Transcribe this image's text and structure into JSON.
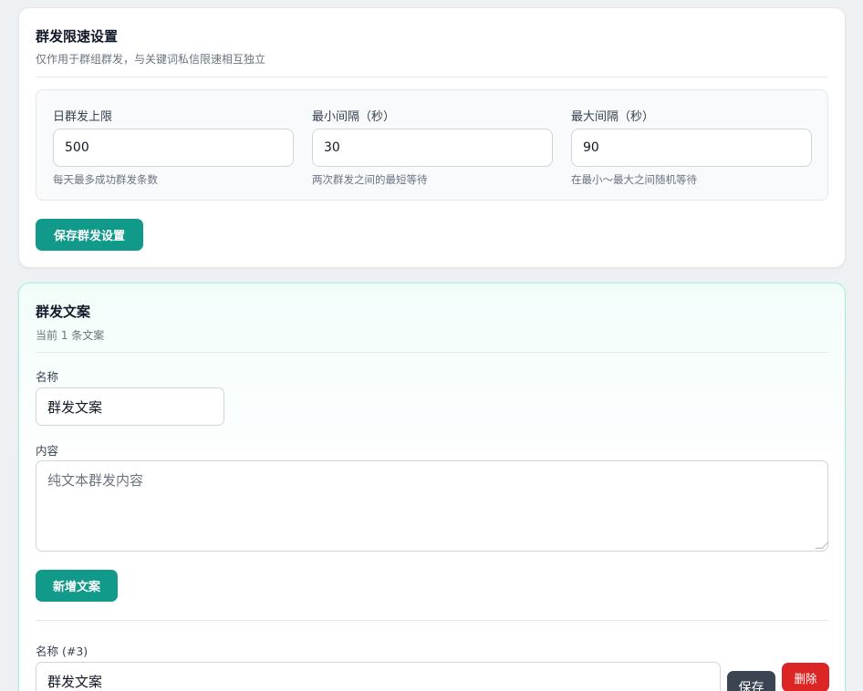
{
  "rate_settings": {
    "title": "群发限速设置",
    "subtitle": "仅作用于群组群发，与关键词私信限速相互独立",
    "fields": [
      {
        "label": "日群发上限",
        "value": "500",
        "help": "每天最多成功群发条数"
      },
      {
        "label": "最小间隔（秒）",
        "value": "30",
        "help": "两次群发之间的最短等待"
      },
      {
        "label": "最大间隔（秒）",
        "value": "90",
        "help": "在最小～最大之间随机等待"
      }
    ],
    "save_label": "保存群发设置"
  },
  "copy_section": {
    "title": "群发文案",
    "subtitle": "当前 1 条文案",
    "new_form": {
      "name_label": "名称",
      "name_value": "群发文案",
      "content_label": "内容",
      "content_placeholder": "纯文本群发内容",
      "add_label": "新增文案"
    },
    "existing": {
      "name_label": "名称 (#3)",
      "name_value": "群发文案",
      "save_label": "保存",
      "delete_label": "删除"
    }
  },
  "colors": {
    "primary": "#11998a",
    "danger": "#dc2626",
    "dark": "#3b4452",
    "accent_border": "#a7f0dc"
  }
}
